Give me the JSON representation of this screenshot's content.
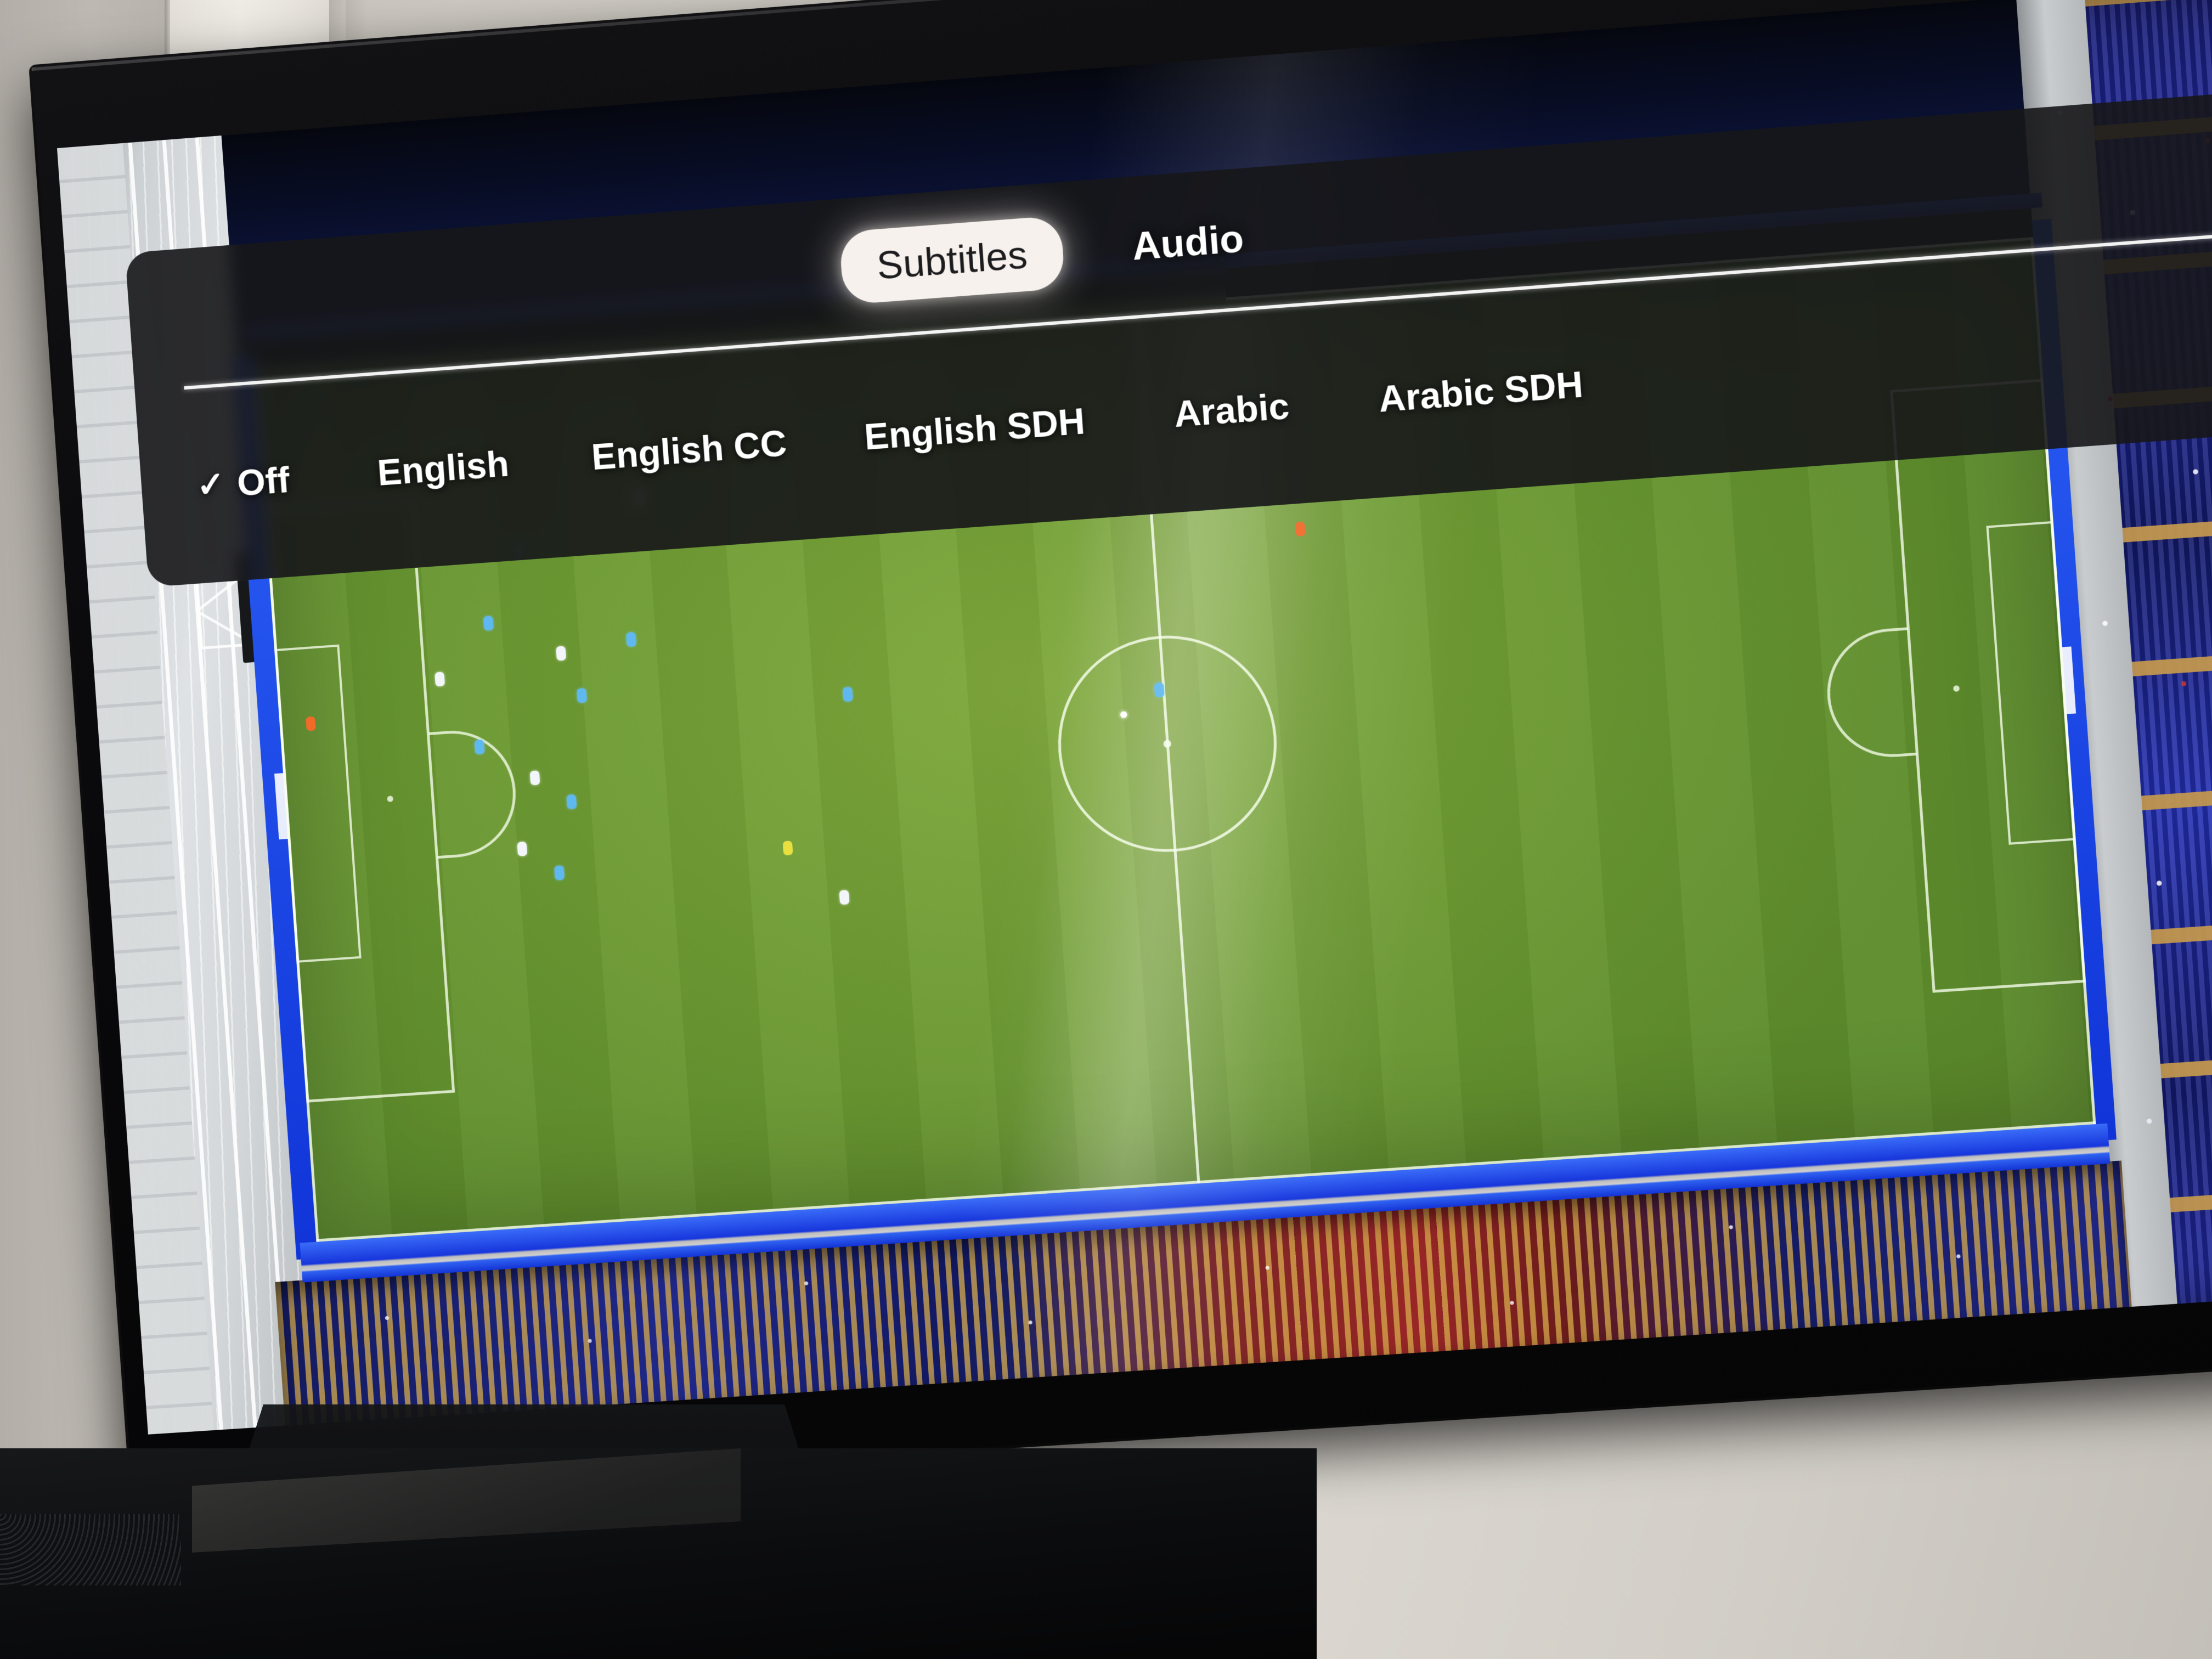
{
  "scene": {
    "description": "Photo of a wall-mounted television displaying a live football match with the media player's subtitle selection overlay open"
  },
  "overlay": {
    "tabs": [
      {
        "label": "Subtitles",
        "active": true
      },
      {
        "label": "Audio",
        "active": false
      }
    ],
    "selected_check_glyph": "✓",
    "options": [
      {
        "label": "Off",
        "selected": true
      },
      {
        "label": "English",
        "selected": false
      },
      {
        "label": "English CC",
        "selected": false
      },
      {
        "label": "English SDH",
        "selected": false
      },
      {
        "label": "Arabic",
        "selected": false
      },
      {
        "label": "Arabic SDH",
        "selected": false
      }
    ],
    "colors": {
      "panel_background": "#161618",
      "active_tab_background": "#f6f1ec",
      "active_tab_text": "#1c1c1e",
      "text": "#ffffff",
      "divider": "#ffffff"
    }
  },
  "video": {
    "content": "football-match",
    "camera": "tactical-aerial",
    "pitch_color": "#6f9c34",
    "perimeter_board_color": "#2b5ff5",
    "home_kit_color": "#5fb9f0",
    "away_kit_color": "#f2f6fa",
    "referee_kit_color": "#f06a2a",
    "crowd_color": "#2029a8"
  },
  "room": {
    "wall_color": "#d9d5ce",
    "accent_glow_color": "#ffaa96",
    "tv_bezel_color": "#0a0a0c",
    "furniture_color": "#0c0d0f"
  }
}
